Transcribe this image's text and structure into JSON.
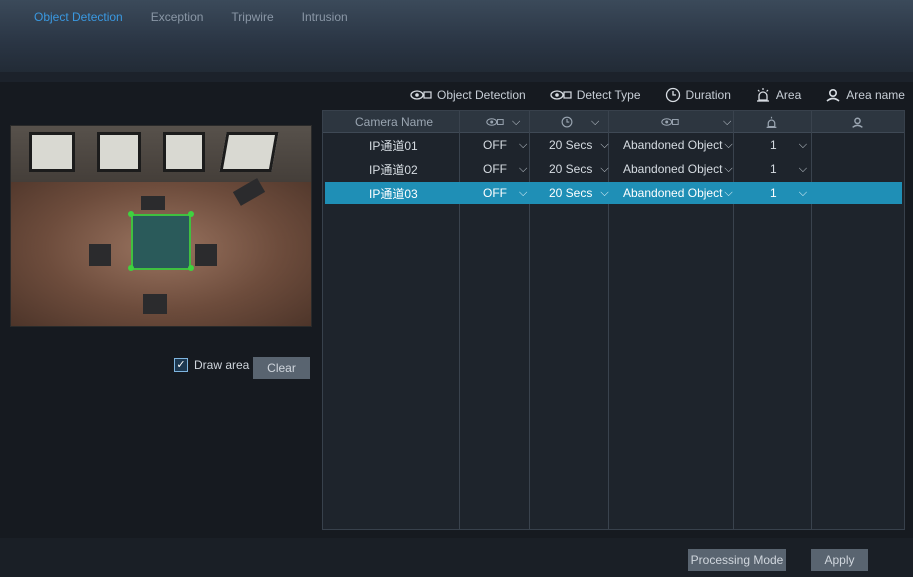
{
  "tabs": [
    {
      "label": "Object Detection",
      "active": true
    },
    {
      "label": "Exception",
      "active": false
    },
    {
      "label": "Tripwire",
      "active": false
    },
    {
      "label": "Intrusion",
      "active": false
    }
  ],
  "legend": {
    "object_detection": "Object Detection",
    "detect_type": "Detect Type",
    "duration": "Duration",
    "area": "Area",
    "area_name": "Area name"
  },
  "table": {
    "header": {
      "camera_name": "Camera Name"
    },
    "rows": [
      {
        "camera": "IP通道01",
        "detection": "OFF",
        "duration": "20 Secs",
        "type": "Abandoned Object",
        "area": "1",
        "area_name": "",
        "selected": false
      },
      {
        "camera": "IP通道02",
        "detection": "OFF",
        "duration": "20 Secs",
        "type": "Abandoned Object",
        "area": "1",
        "area_name": "",
        "selected": false
      },
      {
        "camera": "IP通道03",
        "detection": "OFF",
        "duration": "20 Secs",
        "type": "Abandoned Object",
        "area": "1",
        "area_name": "",
        "selected": true
      }
    ]
  },
  "draw_area": {
    "label": "Draw area",
    "checked": true
  },
  "buttons": {
    "clear": "Clear",
    "processing_mode": "Processing Mode",
    "apply": "Apply"
  },
  "colors": {
    "accent": "#3a98e0",
    "selected_row": "#1f8fb6",
    "button": "#596470"
  },
  "icons": [
    "eye-icon",
    "clock-icon",
    "alarm-icon",
    "person-icon",
    "chevron-down-icon"
  ]
}
